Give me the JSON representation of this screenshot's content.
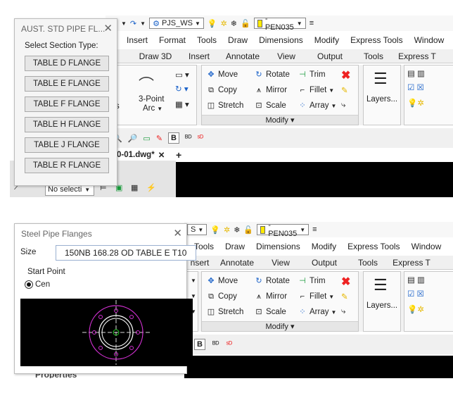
{
  "panel1": {
    "toolbar": {
      "workspace": "PJS_WS",
      "layer": "-PEN035"
    },
    "menu": [
      "Insert",
      "Format",
      "Tools",
      "Draw",
      "Dimensions",
      "Modify",
      "Express Tools",
      "Window"
    ],
    "tabs": [
      "Draw 3D",
      "Insert",
      "Annotate",
      "View",
      "Output",
      "Tools",
      "Express T"
    ],
    "draw_group": {
      "arc_label": "3-Point",
      "arc_sub": "Arc",
      "radius_label": "ius"
    },
    "modify": {
      "title": "Modify",
      "move": "Move",
      "rotate": "Rotate",
      "trim": "Trim",
      "copy": "Copy",
      "mirror": "Mirror",
      "fillet": "Fillet",
      "stretch": "Stretch",
      "scale": "Scale",
      "array": "Array"
    },
    "layers_label": "Layers...",
    "doc_tab": "0-01.dwg*",
    "side": {
      "selection": "No selecti"
    },
    "dialog": {
      "title": "AUST. STD PIPE FL...",
      "prompt": "Select Section Type:",
      "buttons": [
        "TABLE D FLANGE",
        "TABLE E FLANGE",
        "TABLE F FLANGE",
        "TABLE H FLANGE",
        "TABLE J FLANGE",
        "TABLE R FLANGE"
      ]
    }
  },
  "panel2": {
    "toolbar": {
      "workspace": "S",
      "layer": "-PEN035"
    },
    "menu": [
      "Tools",
      "Draw",
      "Dimensions",
      "Modify",
      "Express Tools",
      "Window"
    ],
    "tabs": [
      "nsert",
      "Annotate",
      "View",
      "Output",
      "Tools",
      "Express T"
    ],
    "modify": {
      "title": "Modify",
      "move": "Move",
      "rotate": "Rotate",
      "trim": "Trim",
      "copy": "Copy",
      "mirror": "Mirror",
      "fillet": "Fillet",
      "stretch": "Stretch",
      "scale": "Scale",
      "array": "Array"
    },
    "layers_label": "Layers...",
    "dialog": {
      "title": "Steel Pipe Flanges",
      "size_label": "Size",
      "size_value": "150NB 168.28 OD TABLE E T10",
      "start_point_label": "Start Point",
      "radio_label": "Cen"
    },
    "bottom_text": "Properties"
  },
  "colors": {
    "accent": "#1b62c9",
    "flange": "#d030d0",
    "center": "#22cc22"
  }
}
